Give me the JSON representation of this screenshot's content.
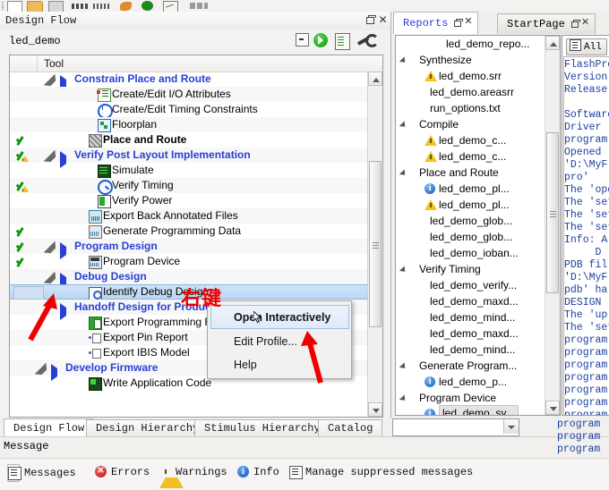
{
  "toolbar": {
    "icons": [
      "new-document-icon",
      "open-folder-icon",
      "save-icon",
      "report-bars-icon",
      "report-bars2-icon",
      "palette-icon",
      "run-icon",
      "edit-icon",
      "misc-icon"
    ]
  },
  "design_flow": {
    "panel_title": "Design Flow",
    "project_name": "led_demo",
    "header_icons": [
      "collapse-all-icon",
      "run-flow-icon",
      "view-report-icon",
      "configure-options-icon"
    ],
    "column_header": "Tool",
    "rows": [
      {
        "label": "Constrain Place and Route",
        "kind": "group",
        "indent": 72,
        "expander": true,
        "arrow": true,
        "status": "",
        "icon": ""
      },
      {
        "label": "Create/Edit I/O Attributes",
        "kind": "item",
        "indent": 98,
        "expander": false,
        "arrow": false,
        "status": "",
        "icon": "io-attributes-icon"
      },
      {
        "label": "Create/Edit Timing Constraints",
        "kind": "item",
        "indent": 98,
        "expander": false,
        "arrow": false,
        "status": "",
        "icon": "timing-constraints-icon"
      },
      {
        "label": "Floorplan",
        "kind": "item",
        "indent": 98,
        "expander": false,
        "arrow": false,
        "status": "",
        "icon": "floorplan-icon"
      },
      {
        "label": "Place and Route",
        "kind": "bold",
        "indent": 88,
        "expander": false,
        "arrow": false,
        "status": "check",
        "icon": "place-and-route-icon"
      },
      {
        "label": "Verify Post Layout Implementation",
        "kind": "group",
        "indent": 72,
        "expander": true,
        "arrow": true,
        "status": "check-warn",
        "icon": ""
      },
      {
        "label": "Simulate",
        "kind": "item",
        "indent": 98,
        "expander": false,
        "arrow": false,
        "status": "",
        "icon": "simulate-icon"
      },
      {
        "label": "Verify Timing",
        "kind": "item",
        "indent": 98,
        "expander": false,
        "arrow": false,
        "status": "check-warn",
        "icon": "verify-timing-icon"
      },
      {
        "label": "Verify Power",
        "kind": "item",
        "indent": 98,
        "expander": false,
        "arrow": false,
        "status": "",
        "icon": "verify-power-icon"
      },
      {
        "label": "Export Back Annotated Files",
        "kind": "item",
        "indent": 88,
        "expander": false,
        "arrow": false,
        "status": "",
        "icon": "export-back-annotated-icon"
      },
      {
        "label": "Generate Programming Data",
        "kind": "item",
        "indent": 88,
        "expander": false,
        "arrow": false,
        "status": "check",
        "icon": "generate-programming-data-icon"
      },
      {
        "label": "Program Design",
        "kind": "group",
        "indent": 72,
        "expander": true,
        "arrow": true,
        "status": "check",
        "icon": ""
      },
      {
        "label": "Program Device",
        "kind": "item",
        "indent": 88,
        "expander": false,
        "arrow": false,
        "status": "check",
        "icon": "program-device-icon"
      },
      {
        "label": "Debug Design",
        "kind": "group",
        "indent": 72,
        "expander": true,
        "arrow": true,
        "status": "",
        "icon": ""
      },
      {
        "label": "Identify Debug Design",
        "kind": "selected",
        "indent": 88,
        "expander": false,
        "arrow": false,
        "status": "selbox",
        "icon": "identify-debug-design-icon"
      },
      {
        "label": "Handoff Design for Production",
        "kind": "group",
        "indent": 72,
        "expander": false,
        "arrow": true,
        "status": "",
        "icon": ""
      },
      {
        "label": "Export Programming File",
        "kind": "item",
        "indent": 88,
        "expander": false,
        "arrow": false,
        "status": "",
        "icon": "export-programming-file-icon"
      },
      {
        "label": "Export Pin Report",
        "kind": "item",
        "indent": 88,
        "expander": false,
        "arrow": false,
        "status": "",
        "icon": "export-pin-report-icon"
      },
      {
        "label": "Export IBIS Model",
        "kind": "item",
        "indent": 88,
        "expander": false,
        "arrow": false,
        "status": "",
        "icon": "export-ibis-model-icon"
      },
      {
        "label": "Develop Firmware",
        "kind": "group",
        "indent": 62,
        "expander": true,
        "arrow": true,
        "status": "",
        "icon": ""
      },
      {
        "label": "Write Application Code",
        "kind": "item",
        "indent": 88,
        "expander": false,
        "arrow": false,
        "status": "",
        "icon": "write-application-code-icon"
      }
    ]
  },
  "context_menu": {
    "items": [
      {
        "label": "Open Interactively",
        "highlighted": true
      },
      {
        "label": "Edit Profile...",
        "highlighted": false
      },
      {
        "label": "Help",
        "highlighted": false
      }
    ]
  },
  "annotation": {
    "chinese_label": "右键"
  },
  "left_tabs": [
    {
      "label": "Design Flow",
      "active": true
    },
    {
      "label": "Design Hierarchy",
      "active": false
    },
    {
      "label": "Stimulus Hierarchy",
      "active": false
    },
    {
      "label": "Catalog",
      "active": false
    }
  ],
  "message_panel": {
    "title": "Message",
    "tools": [
      {
        "label": "Messages",
        "icon": "list-icon",
        "boxed": true
      },
      {
        "label": "Errors",
        "icon": "error-icon",
        "boxed": false
      },
      {
        "label": "Warnings",
        "icon": "warning-icon",
        "boxed": false
      },
      {
        "label": "Info",
        "icon": "info-icon",
        "boxed": false
      },
      {
        "label": "Manage suppressed messages",
        "icon": "list-icon",
        "boxed": false
      }
    ]
  },
  "right_pane": {
    "tabs": [
      {
        "label": "Reports",
        "active": true
      },
      {
        "label": "StartPage",
        "active": false
      }
    ],
    "report_tree": [
      {
        "label": "led_demo_repo...",
        "indent": 56,
        "expander": false,
        "icon": ""
      },
      {
        "label": "Synthesize",
        "indent": 26,
        "expander": true,
        "icon": ""
      },
      {
        "label": "led_demo.srr",
        "indent": 48,
        "expander": false,
        "icon": "warning-icon"
      },
      {
        "label": "led_demo.areasrr",
        "indent": 38,
        "expander": false,
        "icon": ""
      },
      {
        "label": "run_options.txt",
        "indent": 38,
        "expander": false,
        "icon": ""
      },
      {
        "label": "Compile",
        "indent": 26,
        "expander": true,
        "icon": ""
      },
      {
        "label": "led_demo_c...",
        "indent": 48,
        "expander": false,
        "icon": "warning-icon"
      },
      {
        "label": "led_demo_c...",
        "indent": 48,
        "expander": false,
        "icon": "warning-icon"
      },
      {
        "label": "Place and Route",
        "indent": 26,
        "expander": true,
        "icon": ""
      },
      {
        "label": "led_demo_pl...",
        "indent": 48,
        "expander": false,
        "icon": "info-icon"
      },
      {
        "label": "led_demo_pl...",
        "indent": 48,
        "expander": false,
        "icon": "warning-icon"
      },
      {
        "label": "led_demo_glob...",
        "indent": 38,
        "expander": false,
        "icon": ""
      },
      {
        "label": "led_demo_glob...",
        "indent": 38,
        "expander": false,
        "icon": ""
      },
      {
        "label": "led_demo_ioban...",
        "indent": 38,
        "expander": false,
        "icon": ""
      },
      {
        "label": "Verify Timing",
        "indent": 26,
        "expander": true,
        "icon": ""
      },
      {
        "label": "led_demo_verify...",
        "indent": 38,
        "expander": false,
        "icon": ""
      },
      {
        "label": "led_demo_maxd...",
        "indent": 38,
        "expander": false,
        "icon": ""
      },
      {
        "label": "led_demo_mind...",
        "indent": 38,
        "expander": false,
        "icon": ""
      },
      {
        "label": "led_demo_maxd...",
        "indent": 38,
        "expander": false,
        "icon": ""
      },
      {
        "label": "led_demo_mind...",
        "indent": 38,
        "expander": false,
        "icon": ""
      },
      {
        "label": "Generate Program...",
        "indent": 26,
        "expander": true,
        "icon": ""
      },
      {
        "label": "led_demo_p...",
        "indent": 48,
        "expander": false,
        "icon": "info-icon"
      },
      {
        "label": "Program Device",
        "indent": 26,
        "expander": true,
        "icon": ""
      },
      {
        "label": "led_demo_sy...",
        "indent": 48,
        "expander": false,
        "icon": "info-icon",
        "selected": true
      }
    ],
    "log_filter_button": "All",
    "log_text": "FlashPro\nVersion\nRelease\n\nSoftware\nDriver\nprogram\nOpened\n'D:\\MyF\npro'\nThe 'ope\nThe 'set\nThe 'set\nThe 'set\nInfo: A\n     D\nPDB fil\n'D:\\MyF\npdb' ha\nDESIGN\nThe 'up\nThe 'set\nprogram\nprogram\nprogram\nprogram\nprogram\nprogram\nprogram\nprogram",
    "bottom_log_text": "program\nprogram\nprogram"
  },
  "colors": {
    "group_link": "#2a3fd4",
    "annotation_red": "#ef0000",
    "check_green": "#0d9b0d",
    "warning_yellow": "#f0c020",
    "info_blue": "#1358c0",
    "selection_blue": "#bcd8f2"
  }
}
